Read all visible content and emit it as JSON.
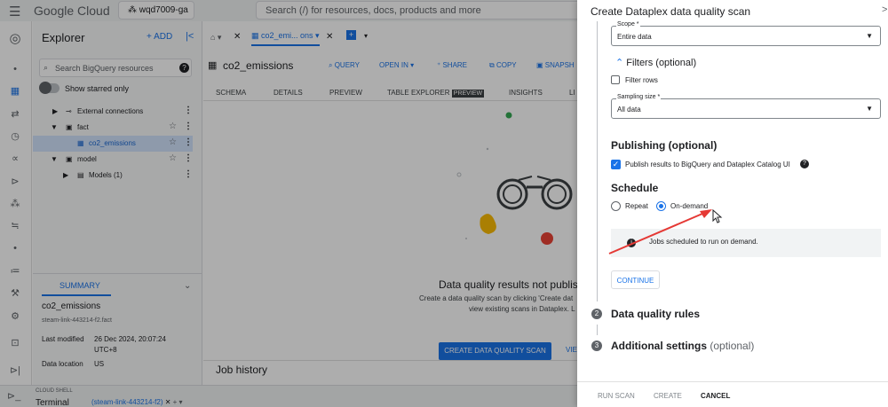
{
  "topbar": {
    "menu_icon": "menu-icon",
    "brand": "Google Cloud",
    "project": "wqd7009-ga",
    "search_placeholder": "Search (/) for resources, docs, products and more"
  },
  "explorer": {
    "title": "Explorer",
    "add_label": "+ ADD",
    "search_placeholder": "Search BigQuery resources",
    "show_starred": "Show starred only",
    "tree": [
      {
        "label": "External connections"
      },
      {
        "label": "fact"
      },
      {
        "label": "co2_emissions"
      },
      {
        "label": "model"
      },
      {
        "label": "Models (1)"
      }
    ],
    "summary": {
      "tab": "SUMMARY",
      "name": "co2_emissions",
      "path": "steam-link-443214-f2.fact",
      "last_modified_key": "Last modified",
      "last_modified_val": "26 Dec 2024, 20:07:24 UTC+8",
      "location_key": "Data location",
      "location_val": "US"
    }
  },
  "main": {
    "tab_label": "co2_emi... ons",
    "table_name": "co2_emissions",
    "actions": {
      "query": "QUERY",
      "open_in": "OPEN IN",
      "share": "SHARE",
      "copy": "COPY",
      "snapshot": "SNAPSH"
    },
    "subtabs": {
      "schema": "SCHEMA",
      "details": "DETAILS",
      "preview": "PREVIEW",
      "explorer": "TABLE EXPLORER",
      "badge": "PREVIEW",
      "insights": "INSIGHTS",
      "lineage": "LI"
    },
    "dq_title": "Data quality results not publish",
    "dq_sub1": "Create a data quality scan by clicking 'Create dat",
    "dq_sub2": "view existing scans in Dataplex. L",
    "create_btn": "CREATE DATA QUALITY SCAN",
    "view_btn": "VIE",
    "job_history": "Job history"
  },
  "shell": {
    "label": "CLOUD SHELL",
    "terminal": "Terminal",
    "tab": "(steam-link-443214-f2)"
  },
  "panel": {
    "title": "Create Dataplex data quality scan",
    "scope_label": "Scope *",
    "scope_value": "Entire data",
    "filters_title": "Filters (optional)",
    "filter_rows": "Filter rows",
    "sampling_label": "Sampling size *",
    "sampling_value": "All data",
    "publishing_title": "Publishing (optional)",
    "publish_label": "Publish results to BigQuery and Dataplex Catalog UI",
    "schedule_title": "Schedule",
    "repeat": "Repeat",
    "on_demand": "On-demand",
    "info_text": "Jobs scheduled to run on demand.",
    "continue": "CONTINUE",
    "step2_num": "2",
    "step2_title": "Data quality rules",
    "step3_num": "3",
    "step3_title": "Additional settings",
    "step3_opt": "(optional)",
    "footer": {
      "run": "RUN SCAN",
      "create": "CREATE",
      "cancel": "CANCEL"
    }
  },
  "colors": {
    "accent": "#1a73e8",
    "arrow": "#e53935"
  }
}
